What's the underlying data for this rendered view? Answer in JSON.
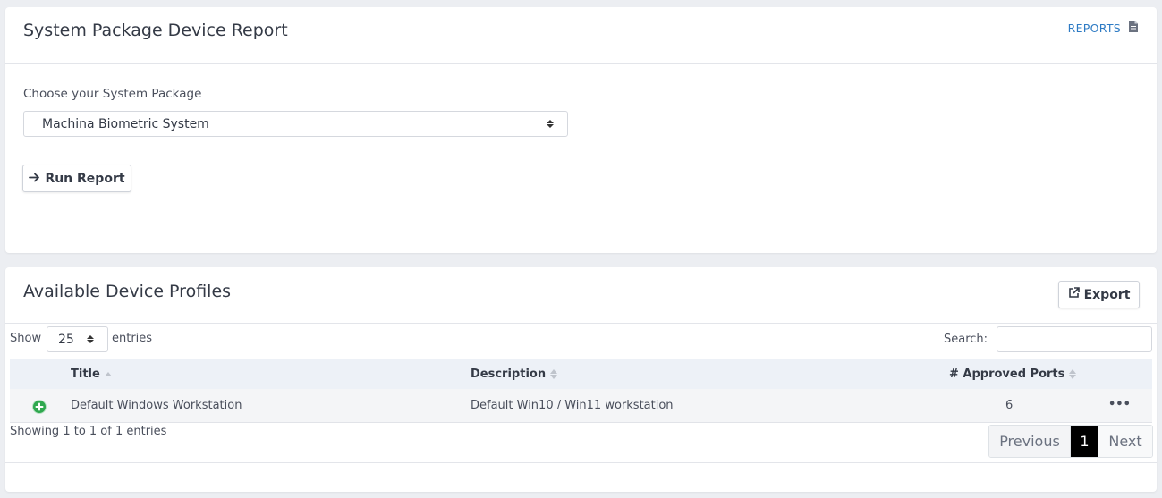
{
  "report": {
    "title": "System Package Device Report",
    "reports_link": "REPORTS",
    "choose_label": "Choose your System Package",
    "selected_package": "Machina Biometric System",
    "run_button": "Run Report"
  },
  "profiles": {
    "title": "Available Device Profiles",
    "export_button": "Export",
    "show_label": "Show",
    "entries_value": "25",
    "entries_label": "entries",
    "search_label": "Search:",
    "search_value": "",
    "columns": [
      "Title",
      "Description",
      "# Approved Ports"
    ],
    "rows": [
      {
        "title": "Default Windows Workstation",
        "description": "Default Win10 / Win11 workstation",
        "ports": "6",
        "actions": "•••"
      }
    ],
    "info": "Showing 1 to 1 of 1 entries",
    "pagination": {
      "previous": "Previous",
      "current": "1",
      "next": "Next"
    }
  },
  "colors": {
    "link": "#2e7bc4",
    "active_page": "#000000",
    "expand_icon": "#2fa84f"
  },
  "icons": {
    "reports": "document-icon",
    "run": "arrow-right-icon",
    "export": "external-link-icon",
    "row_expand": "plus-circle-icon",
    "row_actions": "more-horizontal-icon"
  }
}
